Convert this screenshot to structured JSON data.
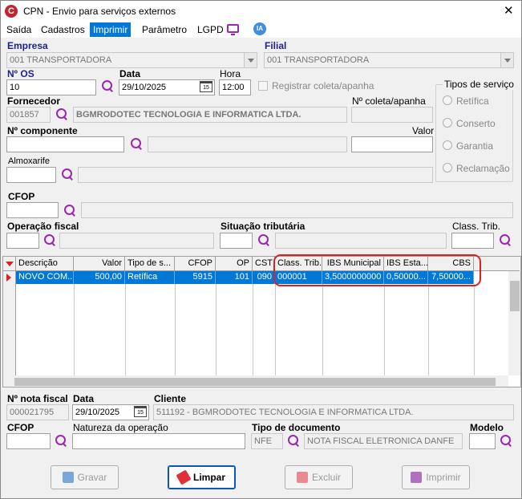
{
  "window": {
    "title": "CPN - Envio para serviços externos",
    "close": "✕",
    "app_icon": "C"
  },
  "menu": [
    {
      "label": "Saída"
    },
    {
      "label": "Cadastros"
    },
    {
      "label": "Imprimir"
    },
    {
      "label": "Parâmetro"
    },
    {
      "label": "LGPD"
    }
  ],
  "ia_label": "IA",
  "form": {
    "empresa": {
      "label": "Empresa",
      "value": "001 TRANSPORTADORA"
    },
    "filial": {
      "label": "Filial",
      "value": "001 TRANSPORTADORA"
    },
    "os": {
      "label": "Nº  OS",
      "value": "10"
    },
    "data": {
      "label": "Data",
      "value": "29/10/2025"
    },
    "hora": {
      "label": "Hora",
      "value": "12:00"
    },
    "registrar": {
      "label": "Registrar coleta/apanha"
    },
    "fornecedor": {
      "label": "Fornecedor",
      "code": "001857",
      "name": "BGMRODOTEC TECNOLOGIA E INFORMATICA LTDA."
    },
    "coleta": {
      "label": "Nº coleta/apanha",
      "value": ""
    },
    "componente": {
      "label": "Nº  componente",
      "value": ""
    },
    "valor": {
      "label": "Valor",
      "value": ""
    },
    "almoxarife": {
      "label": "Almoxarife",
      "value": ""
    },
    "cfop": {
      "label": "CFOP",
      "value": ""
    },
    "operacao": {
      "label": "Operação fiscal",
      "value": ""
    },
    "situacao": {
      "label": "Situação tributária",
      "value": ""
    },
    "class_trib": {
      "label": "Class. Trib.",
      "value": ""
    }
  },
  "tipos": {
    "label": "Tipos de serviço",
    "options": [
      "Retífica",
      "Conserto",
      "Garantia",
      "Reclamação"
    ]
  },
  "grid": {
    "headers": [
      "Descrição",
      "Valor",
      "Tipo de s...",
      "CFOP",
      "OP",
      "CST",
      "Class. Trib.",
      "IBS Municipal",
      "IBS Esta...",
      "CBS"
    ],
    "rows": [
      [
        "NOVO COM...",
        "500,00",
        "Retífica",
        "5915",
        "101",
        "090",
        "000001",
        "3,5000000000",
        "0,50000...",
        "7,50000..."
      ]
    ]
  },
  "nota": {
    "nf": {
      "label": "Nº nota fiscal",
      "value": "000021795"
    },
    "data": {
      "label": "Data",
      "value": "29/10/2025"
    },
    "cliente": {
      "label": "Cliente",
      "value": "511192 - BGMRODOTEC TECNOLOGIA E INFORMATICA LTDA."
    },
    "cfop": {
      "label": "CFOP",
      "value": ""
    },
    "natureza": {
      "label": "Natureza da operação",
      "value": ""
    },
    "tipo_doc": {
      "label": "Tipo de documento",
      "code": "NFE",
      "value": "NOTA FISCAL ELETRONICA DANFE"
    },
    "modelo": {
      "label": "Modelo",
      "value": ""
    }
  },
  "buttons": {
    "gravar": "Gravar",
    "limpar": "Limpar",
    "excluir": "Excluir",
    "imprimir": "Imprimir"
  }
}
